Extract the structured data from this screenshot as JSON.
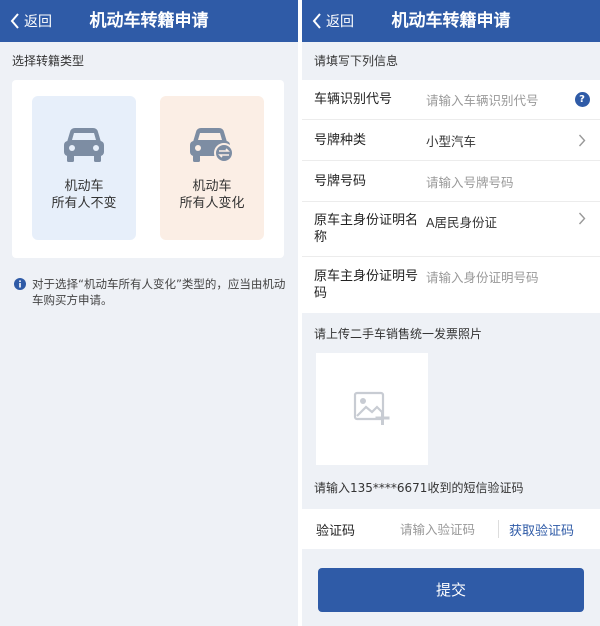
{
  "left": {
    "back_label": "返回",
    "title": "机动车转籍申请",
    "section_label": "选择转籍类型",
    "cards": [
      {
        "line1": "机动车",
        "line2": "所有人不变",
        "icon": "car-icon"
      },
      {
        "line1": "机动车",
        "line2": "所有人变化",
        "icon": "car-transfer-icon"
      }
    ],
    "notice": "对于选择“机动车所有人变化”类型的，应当由机动车购买方申请。"
  },
  "right": {
    "back_label": "返回",
    "title": "机动车转籍申请",
    "section_label": "请填写下列信息",
    "rows": [
      {
        "label": "车辆识别代号",
        "placeholder": "请输入车辆识别代号",
        "trailing": "help-icon",
        "help_glyph": "?"
      },
      {
        "label": "号牌种类",
        "value": "小型汽车",
        "trailing": "chevron-right-icon"
      },
      {
        "label": "号牌号码",
        "placeholder": "请输入号牌号码"
      },
      {
        "label": "原车主身份证明名称",
        "value": "A居民身份证",
        "trailing": "chevron-right-icon"
      },
      {
        "label": "原车主身份证明号码",
        "placeholder": "请输入身份证明号码"
      }
    ],
    "upload_label": "请上传二手车销售统一发票照片",
    "upload_icon": "image-add-icon",
    "sms_hint": "请输入135****6671收到的短信验证码",
    "code_label": "验证码",
    "code_placeholder": "请输入验证码",
    "get_code_label": "获取验证码",
    "submit_label": "提交"
  },
  "colors": {
    "primary": "#2f5ba7",
    "background": "#eef1f6",
    "card_same_bg": "#e7effa",
    "card_change_bg": "#fbeee5",
    "icon_gray": "#7d8da3",
    "help_icon": "#2f5ba7"
  }
}
